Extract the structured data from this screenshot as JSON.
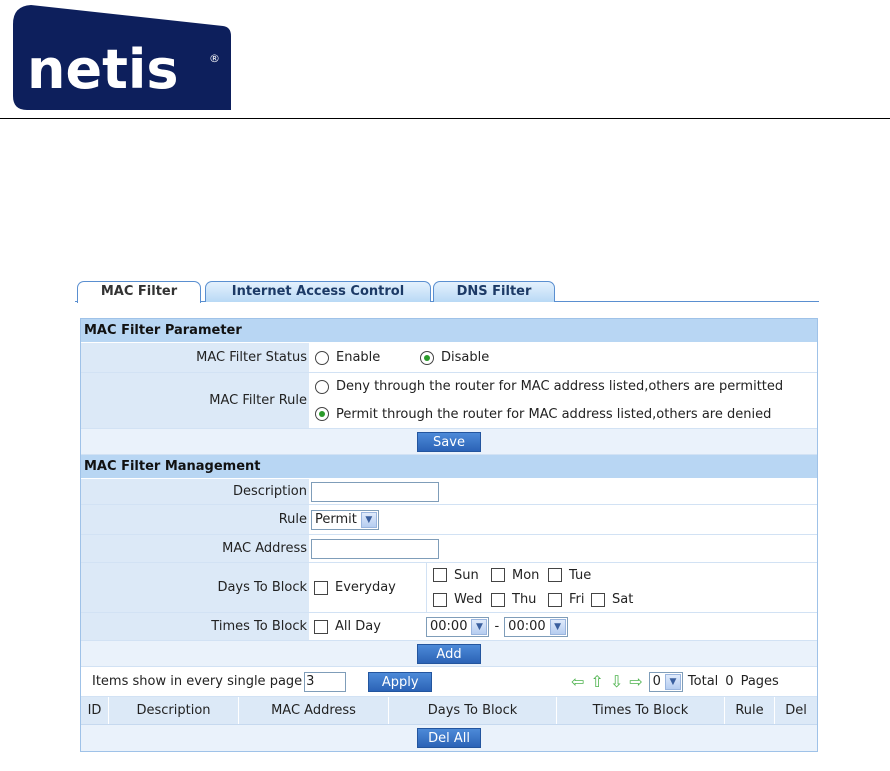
{
  "brand": {
    "logo_text": "netis",
    "logo_bg": "#0d1f5c"
  },
  "tabs": [
    {
      "label": "MAC Filter",
      "active": true
    },
    {
      "label": "Internet Access Control",
      "active": false
    },
    {
      "label": "DNS Filter",
      "active": false
    }
  ],
  "param": {
    "title": "MAC Filter Parameter",
    "status_label": "MAC Filter Status",
    "status_options": [
      "Enable",
      "Disable"
    ],
    "status_selected": "Disable",
    "rule_label": "MAC Filter Rule",
    "rule_options": [
      "Deny through the router for MAC address listed,others are permitted",
      "Permit through the router for MAC address listed,others are denied"
    ],
    "rule_selected": 1,
    "save_label": "Save"
  },
  "mgmt": {
    "title": "MAC Filter Management",
    "description_label": "Description",
    "description_value": "",
    "rule_label": "Rule",
    "rule_value": "Permit",
    "mac_label": "MAC Address",
    "mac_value": "",
    "days_label": "Days To Block",
    "everyday_label": "Everyday",
    "days": [
      "Sun",
      "Mon",
      "Tue",
      "Wed",
      "Thu",
      "Fri",
      "Sat"
    ],
    "times_label": "Times To Block",
    "allday_label": "All Day",
    "time_from": "00:00",
    "time_sep": "-",
    "time_to": "00:00",
    "add_label": "Add"
  },
  "pager": {
    "items_label": "Items show in every single page",
    "items_value": "3",
    "apply_label": "Apply",
    "page_value": "0",
    "total_label": "Total",
    "total_value": "0",
    "pages_label": "Pages"
  },
  "table": {
    "columns": [
      "ID",
      "Description",
      "MAC Address",
      "Days To Block",
      "Times To Block",
      "Rule",
      "Del"
    ],
    "del_all_label": "Del All"
  }
}
